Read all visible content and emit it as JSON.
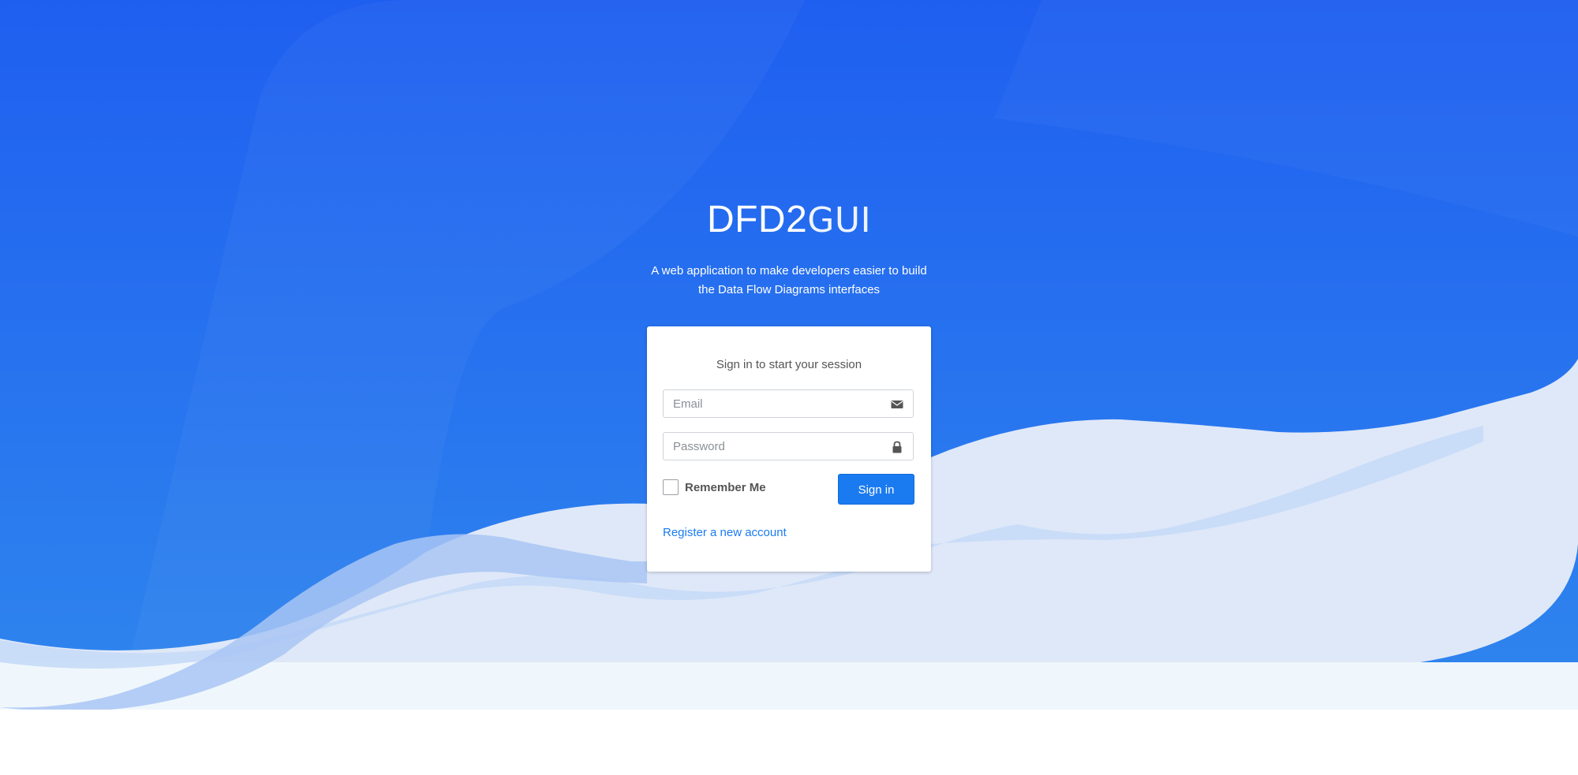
{
  "app": {
    "brand_bold": "DFD2",
    "brand_light": "GUI",
    "tagline_line1": "A web application to make developers easier to build",
    "tagline_line2": "the Data Flow Diagrams interfaces"
  },
  "login": {
    "title": "Sign in to start your session",
    "email_placeholder": "Email",
    "email_value": "",
    "email_icon": "envelope-icon",
    "password_placeholder": "Password",
    "password_value": "",
    "password_icon": "lock-icon",
    "remember_label": "Remember Me",
    "remember_checked": false,
    "signin_label": "Sign in",
    "register_label": "Register a new account"
  },
  "colors": {
    "background_top": "#1f5ff0",
    "background_bottom": "#2f86ee",
    "wave_light": "#dfe8f8",
    "wave_mid": "#c6daf7",
    "footer_band": "#eff7fc",
    "primary": "#1a7bf0",
    "card": "#ffffff"
  }
}
